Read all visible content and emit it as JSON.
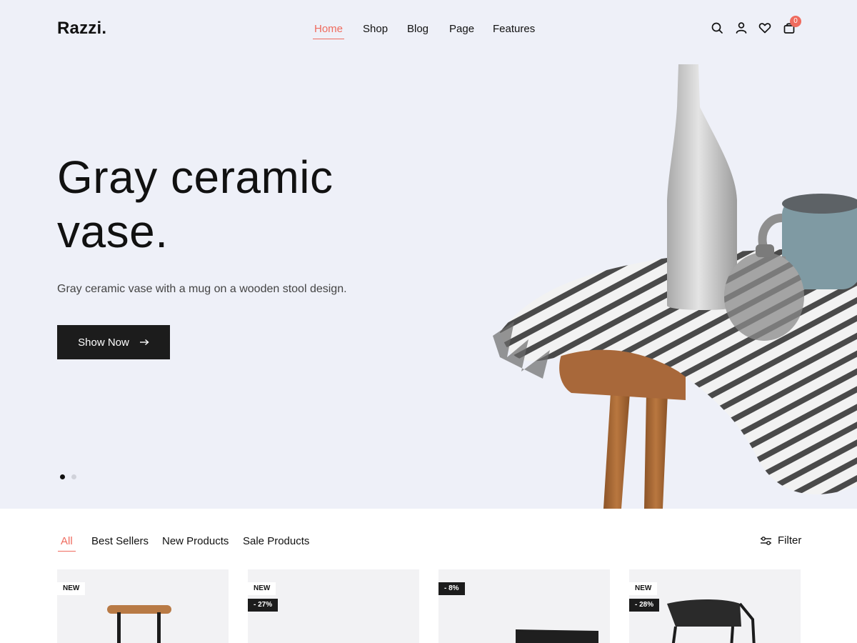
{
  "header": {
    "logo": "Razzi.",
    "nav": [
      "Home",
      "Shop",
      "Blog",
      "Page",
      "Features"
    ],
    "active_nav": "Home",
    "cart_count": "0",
    "icons": [
      "search-icon",
      "user-icon",
      "heart-icon",
      "bag-icon"
    ]
  },
  "hero": {
    "title": "Gray ceramic vase.",
    "subtitle": "Gray ceramic vase with a mug on a wooden stool design.",
    "button_label": "Show Now",
    "slides_count": 2,
    "active_slide": 1
  },
  "products_section": {
    "tabs": [
      "All",
      "Best Sellers",
      "New Products",
      "Sale Products"
    ],
    "active_tab": "All",
    "filter_label": "Filter",
    "cards": [
      {
        "badges": [
          "NEW"
        ]
      },
      {
        "badges": [
          "NEW",
          "- 27%"
        ]
      },
      {
        "badges": [
          "- 8%"
        ]
      },
      {
        "badges": [
          "NEW",
          "- 28%"
        ]
      }
    ]
  },
  "colors": {
    "accent": "#ef6b5e",
    "hero_bg": "#eef0f8",
    "button_bg": "#1c1c1c"
  }
}
